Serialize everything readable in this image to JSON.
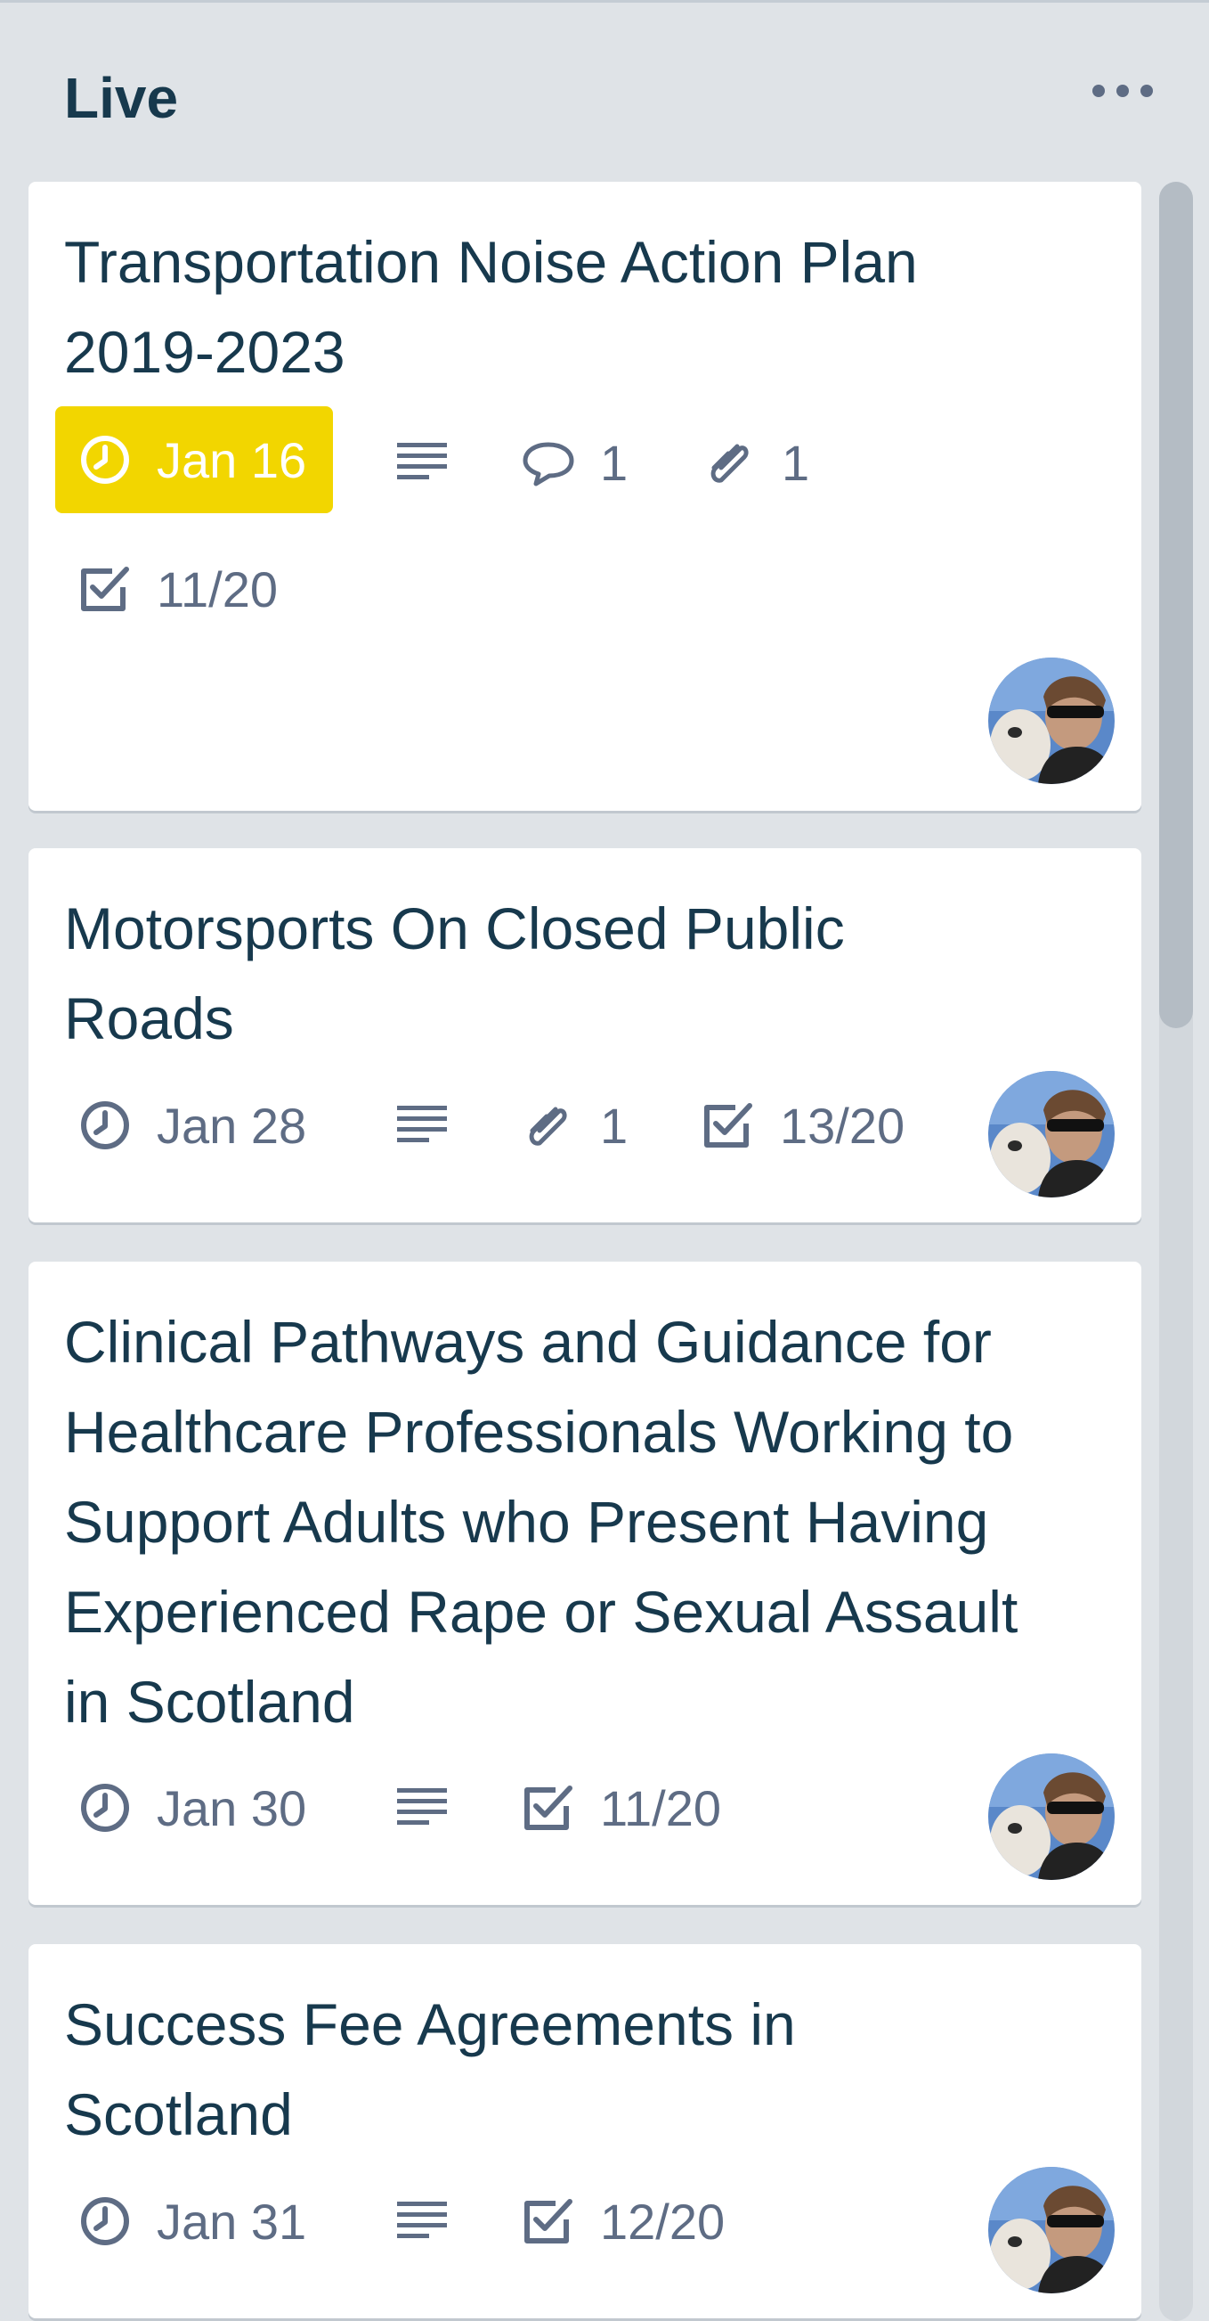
{
  "list": {
    "title": "Live"
  },
  "cards": [
    {
      "title_line1": "Transportation Noise Action Plan",
      "title_line2": "2019-2023",
      "due": "Jan 16",
      "comments": "1",
      "attachments": "1",
      "checklist": "11/20"
    },
    {
      "title_line1": "Motorsports On Closed Public",
      "title_line2": "Roads",
      "due": "Jan 28",
      "attachments": "1",
      "checklist": "13/20"
    },
    {
      "title_line1": "Clinical Pathways and Guidance for",
      "title_line2": "Healthcare Professionals Working to",
      "title_line3": "Support Adults who Present Having",
      "title_line4": "Experienced Rape or Sexual Assault",
      "title_line5": "in Scotland",
      "due": "Jan 30",
      "checklist": "11/20"
    },
    {
      "title_line1": "Success Fee Agreements in",
      "title_line2": "Scotland",
      "due": "Jan 31",
      "checklist": "12/20"
    }
  ],
  "colors": {
    "due_soon": "#f2d600",
    "text": "#17394d",
    "badge": "#5e6c84",
    "list_bg": "#dfe3e7"
  },
  "icons": [
    "clock-icon",
    "description-icon",
    "comment-icon",
    "attachment-icon",
    "checklist-icon",
    "more-icon",
    "avatar"
  ]
}
